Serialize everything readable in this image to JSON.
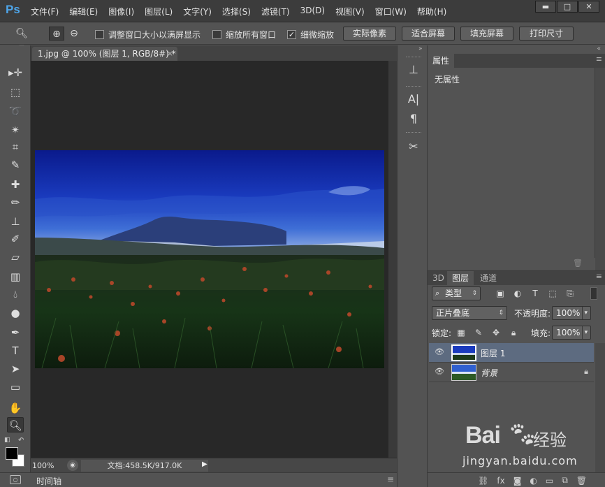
{
  "app": {
    "logo": "Ps"
  },
  "menu": [
    "文件(F)",
    "编辑(E)",
    "图像(I)",
    "图层(L)",
    "文字(Y)",
    "选择(S)",
    "滤镜(T)",
    "3D(D)",
    "视图(V)",
    "窗口(W)",
    "帮助(H)"
  ],
  "window_buttons": {
    "minimize": "▬",
    "maximize": "□",
    "close": "✕"
  },
  "options": {
    "resize_windows": "调整窗口大小以满屏显示",
    "zoom_all": "缩放所有窗口",
    "scrubby_zoom": "细微缩放",
    "scrubby_checked": true,
    "actual_pixels": "实际像素",
    "fit_screen": "适合屏幕",
    "fill_screen": "填充屏幕",
    "print_size": "打印尺寸"
  },
  "document": {
    "tab_title": "1.jpg @ 100% (图层 1, RGB/8#) *",
    "close": "×",
    "zoom": "100%",
    "doc_size": "文档:458.5K/917.0K",
    "timeline": "时间轴"
  },
  "colors": {
    "foreground": "#000000",
    "background": "#ffffff",
    "selected_layer": "#5d6b80"
  },
  "properties": {
    "tab": "属性",
    "empty": "无属性"
  },
  "layers": {
    "tabs": [
      "3D",
      "图层",
      "通道"
    ],
    "active_tab": "图层",
    "filter_kind": "类型",
    "blend_mode": "正片叠底",
    "opacity_label": "不透明度:",
    "opacity_value": "100%",
    "lock_label": "锁定:",
    "fill_label": "填充:",
    "fill_value": "100%",
    "items": [
      {
        "name": "图层 1",
        "selected": true,
        "locked": false
      },
      {
        "name": "背景",
        "selected": false,
        "locked": true
      }
    ],
    "bottom_icons": [
      "link-icon",
      "fx-icon",
      "mask-icon",
      "adjustment-icon",
      "group-icon",
      "new-layer-icon",
      "trash-icon"
    ]
  },
  "watermark": {
    "brand": "Bai",
    "brand_cn": "经验",
    "url": "jingyan.baidu.com"
  }
}
